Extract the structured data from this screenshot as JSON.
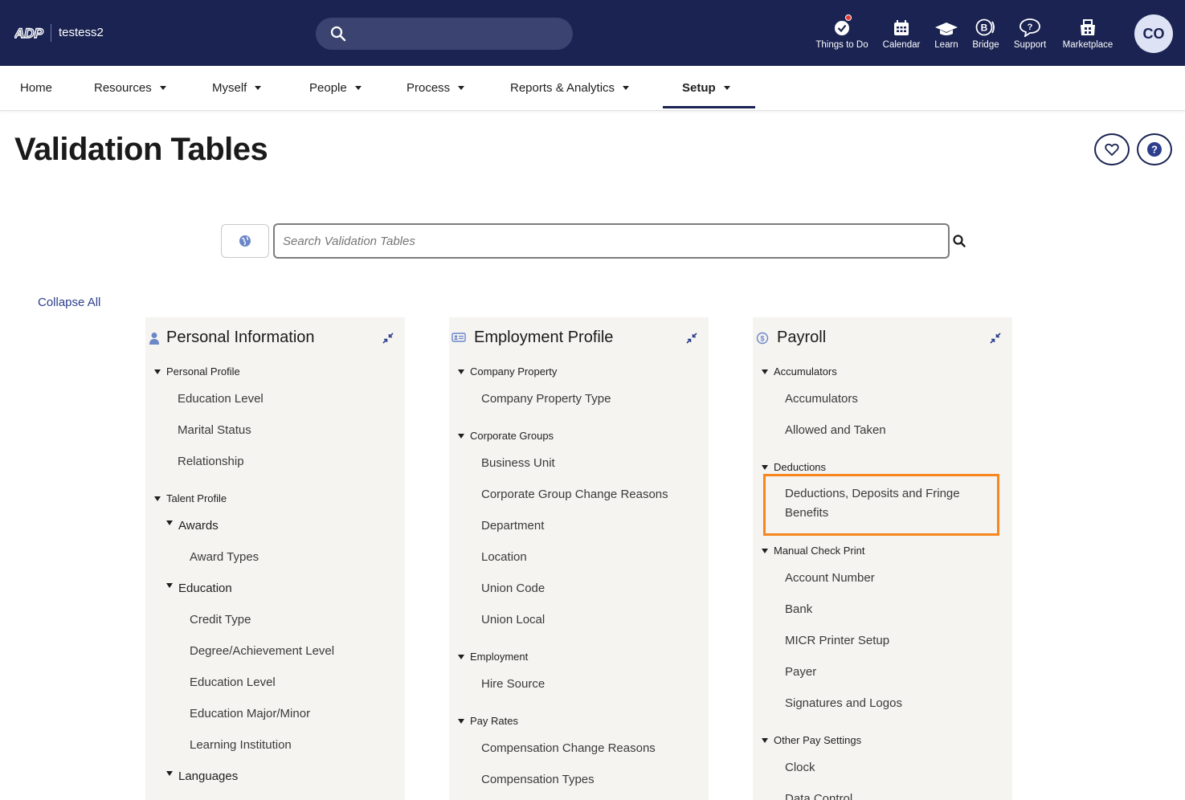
{
  "header": {
    "logo_text": "ADP",
    "tenant": "testess2",
    "icons": [
      {
        "label": "Things to Do",
        "icon": "checkmark-badge-icon"
      },
      {
        "label": "Calendar",
        "icon": "calendar-icon"
      },
      {
        "label": "Learn",
        "icon": "graduation-cap-icon"
      },
      {
        "label": "Bridge",
        "icon": "bridge-icon"
      },
      {
        "label": "Support",
        "icon": "support-chat-icon"
      },
      {
        "label": "Marketplace",
        "icon": "marketplace-icon"
      }
    ],
    "avatar_initials": "CO"
  },
  "nav": {
    "items": [
      {
        "label": "Home"
      },
      {
        "label": "Resources"
      },
      {
        "label": "Myself"
      },
      {
        "label": "People"
      },
      {
        "label": "Process"
      },
      {
        "label": "Reports & Analytics"
      },
      {
        "label": "Setup"
      }
    ],
    "active": "Setup"
  },
  "page": {
    "title": "Validation Tables",
    "search_placeholder": "Search Validation Tables",
    "collapse_all": "Collapse All"
  },
  "panels": [
    {
      "title": "Personal Information",
      "icon": "person-icon",
      "rows": [
        {
          "type": "group",
          "text": "Personal Profile"
        },
        {
          "type": "item",
          "text": "Education Level"
        },
        {
          "type": "item",
          "text": "Marital Status"
        },
        {
          "type": "item",
          "text": "Relationship"
        },
        {
          "type": "group",
          "text": "Talent Profile"
        },
        {
          "type": "sub",
          "text": "Awards"
        },
        {
          "type": "item2",
          "text": "Award Types"
        },
        {
          "type": "sub",
          "text": "Education"
        },
        {
          "type": "item2",
          "text": "Credit Type"
        },
        {
          "type": "item2",
          "text": "Degree/Achievement Level"
        },
        {
          "type": "item2",
          "text": "Education Level"
        },
        {
          "type": "item2",
          "text": "Education Major/Minor"
        },
        {
          "type": "item2",
          "text": "Learning Institution"
        },
        {
          "type": "sub",
          "text": "Languages"
        }
      ]
    },
    {
      "title": "Employment Profile",
      "icon": "id-card-icon",
      "rows": [
        {
          "type": "group",
          "text": "Company Property"
        },
        {
          "type": "item",
          "text": "Company Property Type"
        },
        {
          "type": "group",
          "text": "Corporate Groups"
        },
        {
          "type": "item",
          "text": "Business Unit"
        },
        {
          "type": "item",
          "text": "Corporate Group Change Reasons"
        },
        {
          "type": "item",
          "text": "Department"
        },
        {
          "type": "item",
          "text": "Location"
        },
        {
          "type": "item",
          "text": "Union Code"
        },
        {
          "type": "item",
          "text": "Union Local"
        },
        {
          "type": "group",
          "text": "Employment"
        },
        {
          "type": "item",
          "text": "Hire Source"
        },
        {
          "type": "group",
          "text": "Pay Rates"
        },
        {
          "type": "item",
          "text": "Compensation Change Reasons"
        },
        {
          "type": "item",
          "text": "Compensation Types"
        }
      ]
    },
    {
      "title": "Payroll",
      "icon": "dollar-coin-icon",
      "rows": [
        {
          "type": "group",
          "text": "Accumulators"
        },
        {
          "type": "item",
          "text": "Accumulators"
        },
        {
          "type": "item",
          "text": "Allowed and Taken"
        },
        {
          "type": "group",
          "text": "Deductions"
        },
        {
          "type": "item",
          "text": "Deductions, Deposits and Fringe Benefits"
        },
        {
          "type": "group",
          "text": "Manual Check Print"
        },
        {
          "type": "item",
          "text": "Account Number"
        },
        {
          "type": "item",
          "text": "Bank"
        },
        {
          "type": "item",
          "text": "MICR Printer Setup"
        },
        {
          "type": "item",
          "text": "Payer"
        },
        {
          "type": "item",
          "text": "Signatures and Logos"
        },
        {
          "type": "group",
          "text": "Other Pay Settings"
        },
        {
          "type": "item",
          "text": "Clock"
        },
        {
          "type": "item",
          "text": "Data Control"
        }
      ]
    }
  ],
  "colors": {
    "header_bg": "#1a2352",
    "panel_bg": "#f5f4f1",
    "highlight": "#f7861e",
    "link": "#2c3e8c"
  }
}
